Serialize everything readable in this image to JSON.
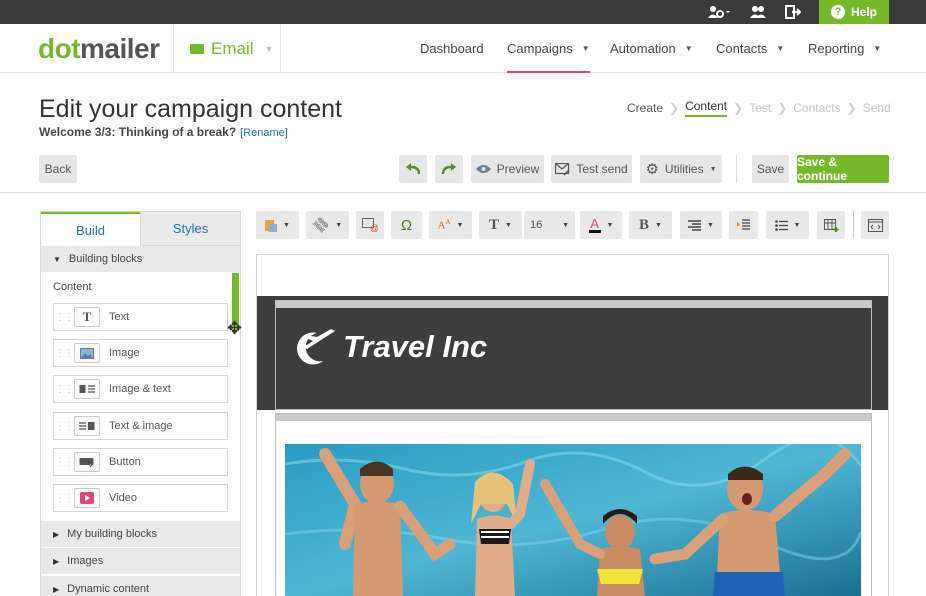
{
  "topbar": {
    "help_label": "Help"
  },
  "header": {
    "logo": {
      "part1": "dot",
      "part2": "mailer"
    },
    "app_name": "Email",
    "nav": [
      {
        "label": "Dashboard"
      },
      {
        "label": "Campaigns"
      },
      {
        "label": "Automation"
      },
      {
        "label": "Contacts"
      },
      {
        "label": "Reporting"
      }
    ]
  },
  "page": {
    "title": "Edit your campaign content",
    "campaign_name": "Welcome 3/3: Thinking of a break?",
    "rename_link": "[Rename]"
  },
  "steps": [
    {
      "label": "Create"
    },
    {
      "label": "Content"
    },
    {
      "label": "Test"
    },
    {
      "label": "Contacts"
    },
    {
      "label": "Send"
    }
  ],
  "actions": {
    "back": "Back",
    "preview": "Preview",
    "test_send": "Test send",
    "utilities": "Utilities",
    "save": "Save",
    "save_continue": "Save & continue"
  },
  "left_panel": {
    "tabs": [
      {
        "label": "Build"
      },
      {
        "label": "Styles"
      }
    ],
    "sections": {
      "building_blocks": "Building blocks",
      "content_label": "Content",
      "my_building_blocks": "My building blocks",
      "images": "Images",
      "dynamic_content": "Dynamic content"
    },
    "blocks": [
      {
        "label": "Text"
      },
      {
        "label": "Image"
      },
      {
        "label": "Image & text"
      },
      {
        "label": "Text & image"
      },
      {
        "label": "Button"
      },
      {
        "label": "Video"
      }
    ]
  },
  "editor": {
    "font_size": "16",
    "brand_text": "Travel Inc"
  },
  "colors": {
    "brand_green": "#77b82a",
    "nav_active": "#e0457b",
    "link_blue": "#1c6fc4",
    "topbar": "#3b3b3b"
  }
}
